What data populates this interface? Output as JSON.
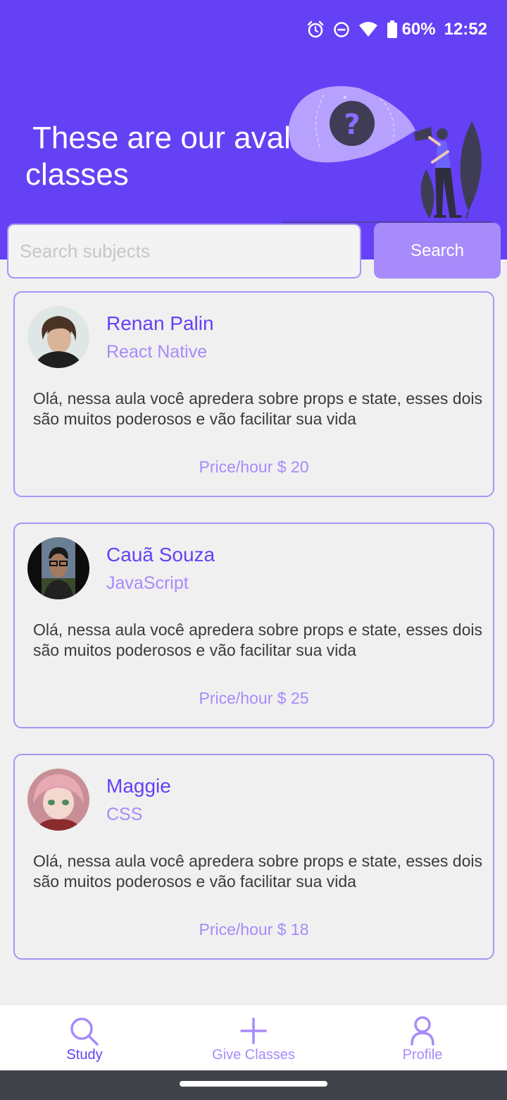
{
  "status_bar": {
    "battery": "60%",
    "time": "12:52"
  },
  "header": {
    "title_line1": "These are our avaliable",
    "title_line2": "classes"
  },
  "search": {
    "placeholder": "Search subjects",
    "value": "",
    "button_label": "Search"
  },
  "teachers": [
    {
      "name": "Renan Palin",
      "subject": "React Native",
      "description": "Olá, nessa aula você apredera sobre props e state, esses dois são muitos poderosos e vão facilitar sua vida",
      "price": "Price/hour $ 20"
    },
    {
      "name": "Cauã Souza",
      "subject": "JavaScript",
      "description": "Olá, nessa aula você apredera sobre props e state, esses dois são muitos poderosos e vão facilitar sua vida",
      "price": "Price/hour $ 25"
    },
    {
      "name": "Maggie",
      "subject": "CSS",
      "description": "Olá, nessa aula você apredera sobre props e state, esses dois são muitos poderosos e vão facilitar sua vida",
      "price": "Price/hour $ 18"
    }
  ],
  "nav": {
    "study": "Study",
    "give_classes": "Give Classes",
    "profile": "Profile"
  },
  "colors": {
    "primary": "#6541f5",
    "accent_light": "#a78bfa",
    "border": "#a893f7",
    "background": "#f0f0f0"
  },
  "icons": [
    "alarm-icon",
    "dnd-icon",
    "wifi-icon",
    "battery-icon",
    "search-icon",
    "plus-icon",
    "user-icon"
  ]
}
